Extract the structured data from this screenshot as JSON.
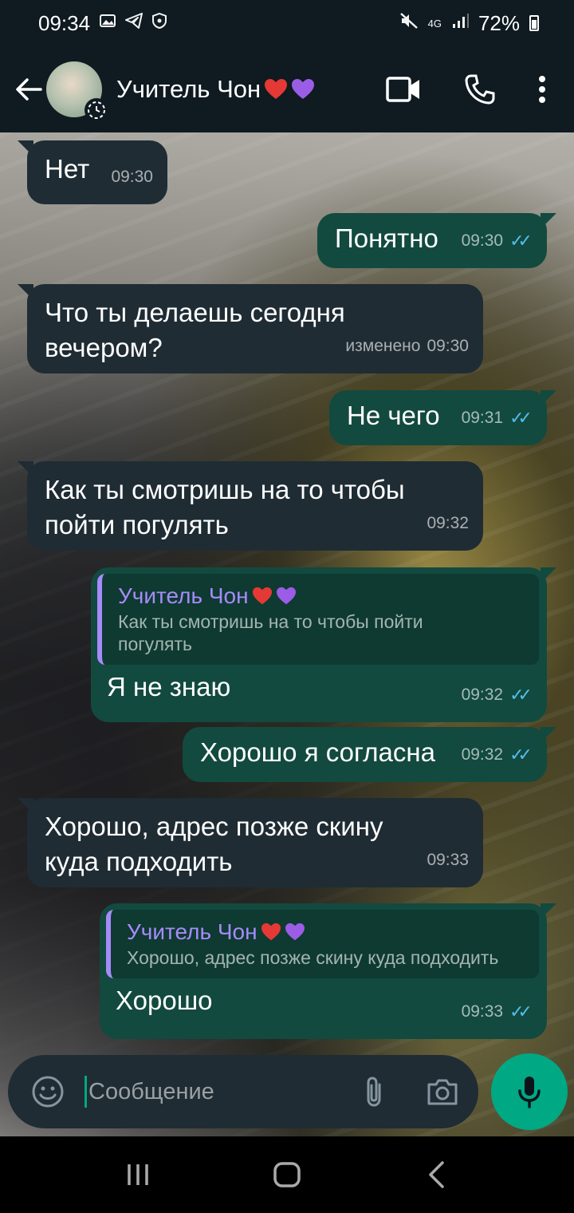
{
  "status_bar": {
    "time": "09:34",
    "battery": "72%",
    "network": "4G"
  },
  "header": {
    "title": "Учитель Чон"
  },
  "messages": [
    {
      "text": "Нет",
      "time": "09:30"
    },
    {
      "text": "Понятно",
      "time": "09:30"
    },
    {
      "text": "Что ты делаешь сегодня вечером?",
      "time": "09:30",
      "edited": "изменено"
    },
    {
      "text": "Не чего",
      "time": "09:31"
    },
    {
      "text": "Как ты смотришь на то чтобы пойти погулять",
      "time": "09:32"
    },
    {
      "quote_name": "Учитель Чон",
      "quote_text": "Как ты смотришь на то чтобы пойти погулять",
      "text": "Я не знаю",
      "time": "09:32"
    },
    {
      "text": "Хорошо я согласна",
      "time": "09:32"
    },
    {
      "text": "Хорошо, адрес позже скину куда подходить",
      "time": "09:33"
    },
    {
      "quote_name": "Учитель Чон",
      "quote_text": "Хорошо, адрес позже скину куда подходить",
      "text": "Хорошо",
      "time": "09:33"
    }
  ],
  "composer": {
    "placeholder": "Сообщение"
  },
  "colors": {
    "accent": "#00a884",
    "incoming": "#1f2c34",
    "outgoing": "#124a3f",
    "quote_name": "#a78bfa",
    "read_ticks": "#53bdeb"
  }
}
